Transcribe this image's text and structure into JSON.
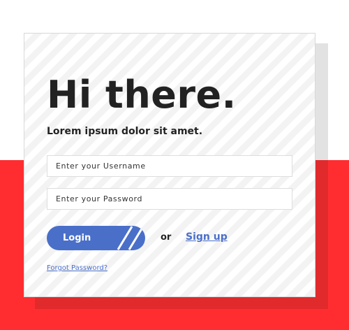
{
  "login": {
    "title": "Hi there.",
    "subtitle": "Lorem ipsum dolor sit amet.",
    "username_placeholder": "Enter your Username",
    "password_placeholder": "Enter your Password",
    "login_label": "Login",
    "or_text": "or",
    "signup_label": "Sign up",
    "forgot_label": "Forgot Password?"
  },
  "colors": {
    "accent": "#4a6fc9",
    "background_red": "#ff2d30",
    "text": "#222222"
  }
}
